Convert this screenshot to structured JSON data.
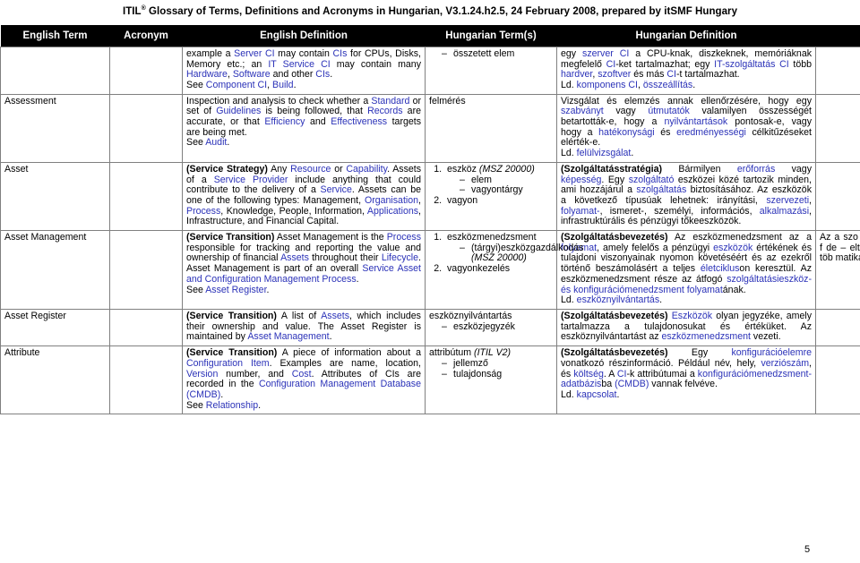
{
  "document": {
    "header_prefix": "ITIL",
    "header_mark": "®",
    "header_rest": " Glossary of Terms, Definitions and Acronyms in Hungarian, V3.1.24.h2.5, 24 February 2008, prepared by itSMF Hungary",
    "page_number": "5"
  },
  "table": {
    "columns": [
      {
        "key": "term",
        "label": "English Term"
      },
      {
        "key": "acronym",
        "label": "Acronym"
      },
      {
        "key": "english_definition",
        "label": "English Definition"
      },
      {
        "key": "hungarian_term",
        "label": "Hungarian Term(s)"
      },
      {
        "key": "hungarian_definition",
        "label": "Hungarian Definition"
      },
      {
        "key": "extra",
        "label": ""
      }
    ],
    "rows": [
      {
        "term": "",
        "acronym": "",
        "english_definition_html": "example a <span class=\"lnk\">Server</span> <span class=\"lnk\">CI</span> may contain <span class=\"lnk\">CIs</span> for CPUs, Disks, Memory etc.; an <span class=\"lnk\">IT Service</span> <span class=\"lnk\">CI</span> may contain many <span class=\"lnk\">Hardware</span>, <span class=\"lnk\">Software</span> and other <span class=\"lnk\">CIs</span>.<br>See <span class=\"lnk\">Component CI</span>, <span class=\"lnk\">Build</span>.",
        "hungarian_term_html": "<ul class=\"dashlist\"><li>összetett elem</li></ul>",
        "hungarian_definition_html": "egy <span class=\"lnk\">szerver</span> <span class=\"lnk\">CI</span> a CPU-knak, diszkeknek, memóriáknak megfelelő <span class=\"lnk\">CI</span>-ket tartalmazhat; egy <span class=\"lnk\">IT-szolgáltatás</span> <span class=\"lnk\">CI</span> több <span class=\"lnk\">hardver</span>, <span class=\"lnk\">szoftver</span> és más <span class=\"lnk\">CI</span>-t tartalmazhat.<br>Ld. <span class=\"lnk\">komponens CI</span>, <span class=\"lnk\">összeállítás</span>.",
        "extra_html": ""
      },
      {
        "term": "Assessment",
        "acronym": "",
        "english_definition_html": "Inspection and analysis to check whether a <span class=\"lnk\">Standard</span> or set of <span class=\"lnk\">Guidelines</span> is being followed, that <span class=\"lnk\">Records</span> are accurate, or that <span class=\"lnk\">Efficiency</span> and <span class=\"lnk\">Effectiveness</span> targets are being met.<br>See <span class=\"lnk\">Audit</span>.",
        "hungarian_term_html": "<div class=\"plainterm\">felmérés</div>",
        "hungarian_definition_html": "Vizsgálat és elemzés annak ellenőrzésére, hogy egy <span class=\"lnk\">szabványt</span> vagy <span class=\"lnk\">útmutatók</span> valamilyen összességét betartották-e, hogy a <span class=\"lnk\">nyilvántartások</span> pontosak-e, vagy hogy a <span class=\"lnk\">hatékonysági</span> és <span class=\"lnk\">eredményességi</span> célkitűzéseket elérték-e.<br>Ld. <span class=\"lnk\">felülvizsgálat</span>.",
        "extra_html": ""
      },
      {
        "term": "Asset",
        "acronym": "",
        "english_definition_html": "<span class=\"bold\">(Service Strategy)</span> Any <span class=\"lnk\">Resource</span> or <span class=\"lnk\">Capability</span>. Assets of a <span class=\"lnk\">Service Provider</span> include anything that could contribute to the delivery of a <span class=\"lnk\">Service</span>. Assets can be one of the following types: Management, <span class=\"lnk\">Organisation</span>, <span class=\"lnk\">Process</span>, Knowledge, People, Information, <span class=\"lnk\">Applications</span>, Infrastructure, and Financial Capital.",
        "hungarian_term_html": "<ol class=\"numlist\"><li>eszköz <span class=\"ital\">(MSZ 20000)</span><ul class=\"dashlist\"><li>elem</li><li>vagyontárgy</li></ul></li><li>vagyon</li></ol>",
        "hungarian_definition_html": "<span class=\"bold\">(Szolgáltatásstratégia)</span> Bármilyen <span class=\"lnk\">erőforrás</span> vagy <span class=\"lnk\">képesség</span>. Egy <span class=\"lnk\">szolgáltató</span> eszközei közé tartozik minden, ami hozzájárul a <span class=\"lnk\">szolgáltatás</span> biztosításához. Az eszközök a következő típusúak lehetnek: irányítási, <span class=\"lnk\">szervezeti</span>, <span class=\"lnk\">folyamat-</span>, ismeret-, személyi, információs, <span class=\"lnk\">alkalmazási</span>, infrastruktúrális és pénzügyi tőkeeszközök.",
        "extra_html": ""
      },
      {
        "term": "Asset Management",
        "acronym": "",
        "english_definition_html": "<span class=\"bold\">(Service Transition)</span> Asset Management is the <span class=\"lnk\">Process</span> responsible for tracking and reporting the value and ownership of financial <span class=\"lnk\">Assets</span> throughout their <span class=\"lnk\">Lifecycle</span>. Asset Management is part of an overall <span class=\"lnk\">Service Asset and Configuration Management Process</span>.<br>See <span class=\"lnk\">Asset Register</span>.",
        "hungarian_term_html": "<ol class=\"numlist\"><li>eszközmenedzsment<ul class=\"dashlist\"><li>(tárgyi)eszközgazdálkodás <span class=\"ital\">(MSZ 20000)</span></li></ul></li><li>vagyonkezelés</li></ol>",
        "hungarian_definition_html": "<span class=\"bold\">(Szolgáltatásbevezetés)</span> Az eszközmenedzsment az a <span class=\"lnk\">folyamat</span>, amely felelős a pénzügyi <span class=\"lnk\">eszközök</span> értékének és tulajdoni viszonyainak nyomon követéséért és az ezekről történő beszámolásért a teljes <span class=\"lnk\">életciklus</span>on keresztül. Az eszközmenedzsment része az átfogó <span class=\"lnk\">szolgáltatásieszköz- és konfigurációmenedzsment folyamat</span>ának.<br>Ld. <span class=\"lnk\">eszköznyilvántartás</span>.",
        "extra_html": "Az a szo eszközö gazdálko denkori f de – elté kapcsola nek kiala vagy töb matikai i"
      },
      {
        "term": "Asset Register",
        "acronym": "",
        "english_definition_html": "<span class=\"bold\">(Service Transition)</span> A list of <span class=\"lnk\">Assets</span>, which includes their ownership and value. The Asset Register is maintained by <span class=\"lnk\">Asset Management</span>.",
        "hungarian_term_html": "<div class=\"plainterm\">eszköznyilvántartás</div><ul class=\"dashlist\"><li>eszközjegyzék</li></ul>",
        "hungarian_definition_html": "<span class=\"bold\">(Szolgáltatásbevezetés)</span> <span class=\"lnk\">Eszközök</span> olyan jegyzéke, amely tartalmazza a tulajdonosukat és értéküket. Az eszköznyilvántartást az <span class=\"lnk\">eszközmenedzsment</span> vezeti.",
        "extra_html": ""
      },
      {
        "term": "Attribute",
        "acronym": "",
        "english_definition_html": "<span class=\"bold\">(Service Transition)</span> A piece of information about a <span class=\"lnk\">Configuration Item</span>. Examples are name, location, <span class=\"lnk\">Version</span> number, and <span class=\"lnk\">Cost</span>. Attributes of CIs are recorded in the <span class=\"lnk\">Configuration Management Database (CMDB)</span>.<br>See <span class=\"lnk\">Relationship</span>.",
        "hungarian_term_html": "<div class=\"plainterm\">attribútum <span class=\"ital\">(ITIL V2)</span></div><ul class=\"dashlist\"><li>jellemző</li><li>tulajdonság</li></ul>",
        "hungarian_definition_html": "<span class=\"bold\">(Szolgáltatásbevezetés)</span> Egy <span class=\"lnk\">konfigurációelemre</span> vonatkozó részinformáció. Például név, hely, <span class=\"lnk\">verziószám</span>, és <span class=\"lnk\">költség</span>. A <span class=\"lnk\">CI</span>-k attribútumai a <span class=\"lnk\">konfigurációmenedzsment-adatbázis</span>ba <span class=\"lnk\">(CMDB)</span> vannak felvéve.<br>Ld. <span class=\"lnk\">kapcsolat</span>.",
        "extra_html": ""
      }
    ]
  }
}
